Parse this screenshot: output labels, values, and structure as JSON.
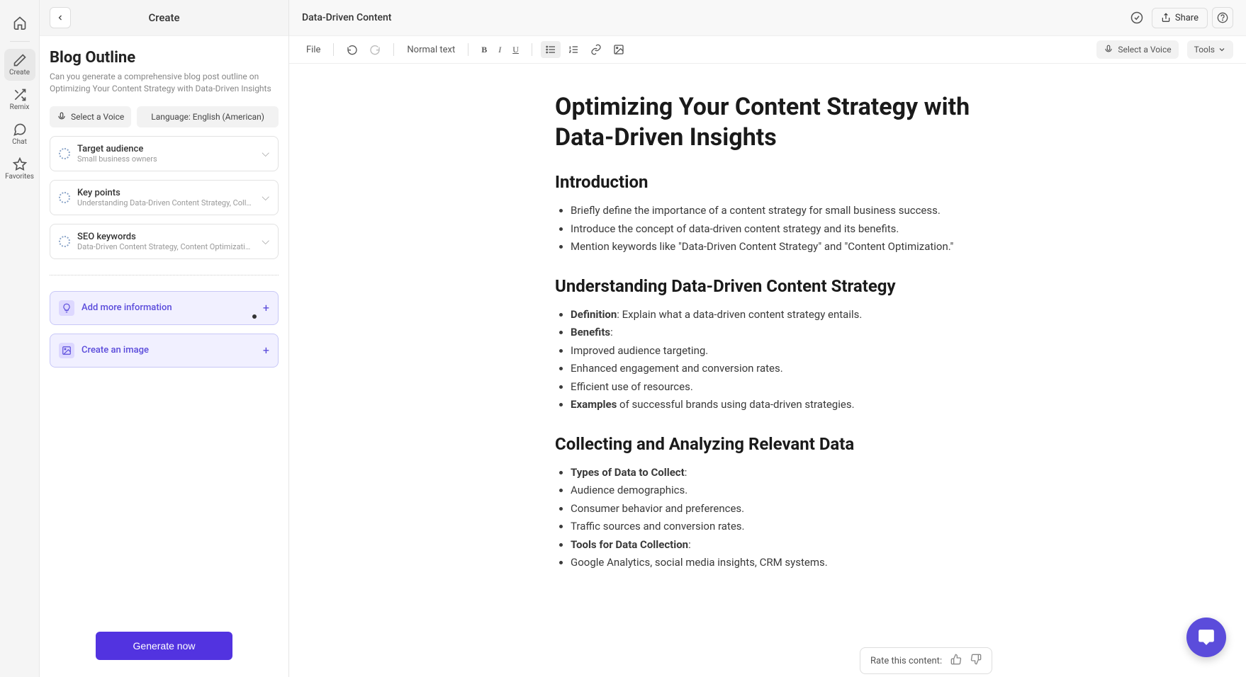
{
  "nav": {
    "items": [
      {
        "label": "",
        "name": "home"
      },
      {
        "label": "Create",
        "name": "create",
        "active": true
      },
      {
        "label": "Remix",
        "name": "remix"
      },
      {
        "label": "Chat",
        "name": "chat"
      },
      {
        "label": "Favorites",
        "name": "favorites"
      }
    ]
  },
  "sidebar": {
    "header_title": "Create",
    "title": "Blog Outline",
    "description": "Can you generate a comprehensive blog post outline on Optimizing Your Content Strategy with Data-Driven Insights",
    "voice_chip": "Select a Voice",
    "language_chip": "Language: English (American)",
    "fields": [
      {
        "name": "target-audience",
        "title": "Target audience",
        "sub": "Small business owners"
      },
      {
        "name": "key-points",
        "title": "Key points",
        "sub": "Understanding Data-Driven Content Strategy, Collectin..."
      },
      {
        "name": "seo-keywords",
        "title": "SEO keywords",
        "sub": "Data-Driven Content Strategy, Content Optimization, M..."
      }
    ],
    "add_info_label": "Add more information",
    "create_image_label": "Create an image",
    "generate_label": "Generate now"
  },
  "header": {
    "doc_title": "Data-Driven Content",
    "share_label": "Share"
  },
  "toolbar": {
    "file_label": "File",
    "style_label": "Normal text",
    "voice_label": "Select a Voice",
    "tools_label": "Tools"
  },
  "document": {
    "title": "Optimizing Your Content Strategy with Data-Driven Insights",
    "sections": [
      {
        "heading": "Introduction",
        "items": [
          {
            "text": "Briefly define the importance of a content strategy for small business success."
          },
          {
            "text": "Introduce the concept of data-driven content strategy and its benefits."
          },
          {
            "text": "Mention keywords like \"Data-Driven Content Strategy\" and \"Content Optimization.\""
          }
        ]
      },
      {
        "heading": "Understanding Data-Driven Content Strategy",
        "items": [
          {
            "bold": "Definition",
            "text": ": Explain what a data-driven content strategy entails."
          },
          {
            "bold": "Benefits",
            "text": ":"
          },
          {
            "text": "Improved audience targeting."
          },
          {
            "text": "Enhanced engagement and conversion rates."
          },
          {
            "text": "Efficient use of resources."
          },
          {
            "bold": "Examples",
            "text": " of successful brands using data-driven strategies."
          }
        ]
      },
      {
        "heading": "Collecting and Analyzing Relevant Data",
        "items": [
          {
            "bold": "Types of Data to Collect",
            "text": ":"
          },
          {
            "text": "Audience demographics."
          },
          {
            "text": "Consumer behavior and preferences."
          },
          {
            "text": "Traffic sources and conversion rates."
          },
          {
            "bold": "Tools for Data Collection",
            "text": ":"
          },
          {
            "text": "Google Analytics, social media insights, CRM systems."
          }
        ]
      }
    ]
  },
  "rate": {
    "label": "Rate this content:"
  }
}
